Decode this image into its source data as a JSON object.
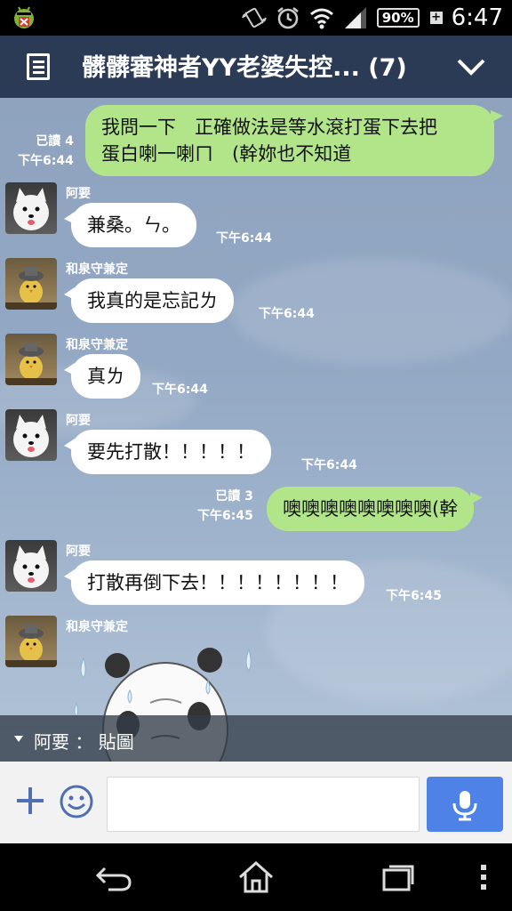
{
  "status_bar": {
    "battery": "90%",
    "battery_plus": "+",
    "clock": "6:47"
  },
  "header": {
    "title": "髒髒審神者YY老婆失控... (7)"
  },
  "messages": [
    {
      "side": "mine",
      "lines": [
        "我問一下　正確做法是等水滾打蛋下去把",
        "蛋白喇一喇ㄇ　(幹妳也不知道"
      ],
      "read": "已讀 4",
      "time": "下午6:44"
    },
    {
      "side": "theirs",
      "sender": "阿要",
      "avatar": "dog",
      "text": "兼桑。ㄣ。",
      "time": "下午6:44"
    },
    {
      "side": "theirs",
      "sender": "和泉守兼定",
      "avatar": "chick",
      "text": "我真的是忘記ㄌ",
      "time": "下午6:44"
    },
    {
      "side": "theirs",
      "sender": "和泉守兼定",
      "avatar": "chick",
      "text": "真ㄌ",
      "time": "下午6:44"
    },
    {
      "side": "theirs",
      "sender": "阿要",
      "avatar": "dog",
      "text": "要先打散！！！！！",
      "time": "下午6:44"
    },
    {
      "side": "mine",
      "text": "噢噢噢噢噢噢噢噢(幹",
      "read": "已讀 3",
      "time": "下午6:45"
    },
    {
      "side": "theirs",
      "sender": "阿要",
      "avatar": "dog",
      "text": "打散再倒下去！！！！！！！！",
      "time": "下午6:45"
    },
    {
      "side": "theirs",
      "sender": "和泉守兼定",
      "avatar": "chick",
      "sticker": "panda-sticker"
    }
  ],
  "reply_banner": {
    "name": "阿要",
    "separator": "：",
    "content": "貼圖"
  },
  "input": {
    "placeholder": ""
  },
  "colors": {
    "header_bg": "#2c3b55",
    "my_bubble": "#b2e58a",
    "their_bubble": "#ffffff",
    "mic_button": "#4e82e6"
  },
  "icons": {
    "menu": "menu-icon",
    "collapse": "chevron-down-icon",
    "add": "plus-icon",
    "emoji": "smiley-icon",
    "mic": "mic-icon",
    "back": "back-icon",
    "home": "home-icon",
    "recents": "recents-icon",
    "more": "more-vertical-icon"
  }
}
